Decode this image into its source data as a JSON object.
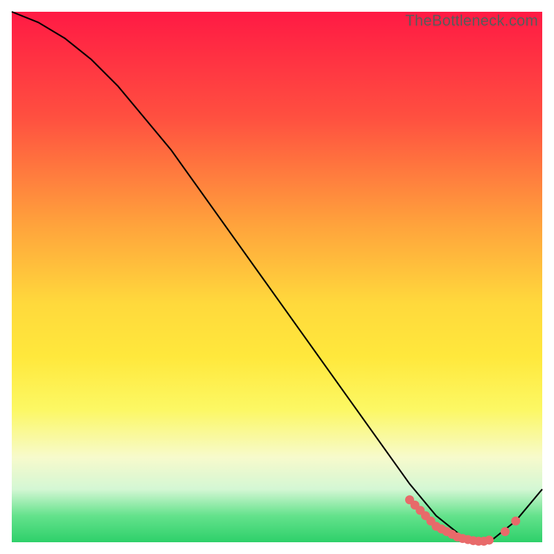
{
  "watermark": "TheBottleneck.com",
  "colors": {
    "gradient_top": "#ff1a44",
    "gradient_mid": "#ffe83c",
    "gradient_bottom": "#2ed06a",
    "curve": "#000000",
    "marker": "#e86a6a"
  },
  "chart_data": {
    "type": "line",
    "title": "",
    "xlabel": "",
    "ylabel": "",
    "xlim": [
      0,
      100
    ],
    "ylim": [
      0,
      100
    ],
    "grid": false,
    "legend": false,
    "annotations": [
      "TheBottleneck.com"
    ],
    "series": [
      {
        "name": "curve",
        "x": [
          0,
          5,
          10,
          15,
          20,
          25,
          30,
          35,
          40,
          45,
          50,
          55,
          60,
          65,
          70,
          75,
          80,
          85,
          90,
          95,
          100
        ],
        "y": [
          100,
          98,
          95,
          91,
          86,
          80,
          74,
          67,
          60,
          53,
          46,
          39,
          32,
          25,
          18,
          11,
          5,
          1,
          0,
          4,
          10
        ]
      },
      {
        "name": "markers",
        "x": [
          75,
          76,
          77,
          78,
          79,
          80,
          81,
          82,
          83,
          84,
          85,
          86,
          87,
          88,
          89,
          90,
          93,
          95
        ],
        "y": [
          8,
          7,
          6,
          5,
          4,
          3,
          2.5,
          2,
          1.5,
          1,
          0.7,
          0.5,
          0.3,
          0.2,
          0.2,
          0.4,
          2,
          4
        ]
      }
    ]
  }
}
